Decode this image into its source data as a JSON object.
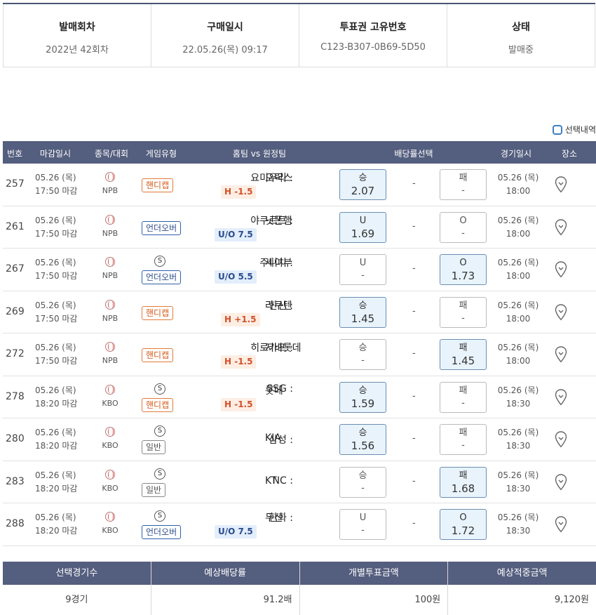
{
  "info": {
    "items": [
      {
        "label": "발매회차",
        "value": "2022년 42회차"
      },
      {
        "label": "구매일시",
        "value": "22.05.26(목) 09:17"
      },
      {
        "label": "투표권 고유번호",
        "value": "C123-B307-0B69-5D50"
      },
      {
        "label": "상태",
        "value": "발매중"
      }
    ]
  },
  "select_label": "선택내역",
  "columns": [
    "번호",
    "마감일시",
    "종목/대회",
    "게임유형",
    "홈팀 vs 원정팀",
    "배당률선택",
    "경기일시",
    "장소"
  ],
  "rows": [
    {
      "no": "257",
      "close_date": "05.26 (목)",
      "close_time": "17:50 마감",
      "league": "NPB",
      "special": "",
      "type": "핸디캡",
      "home": "요미우리",
      "away": "오릭스",
      "handicap": "H -1.5",
      "b1_label": "승",
      "b1_odds": "2.07",
      "b1_on": true,
      "b2_label": "패",
      "b2_odds": "-",
      "b2_on": false,
      "game_date": "05.26 (목)",
      "game_time": "18:00"
    },
    {
      "no": "261",
      "close_date": "05.26 (목)",
      "close_time": "17:50 마감",
      "league": "NPB",
      "special": "",
      "type": "언더오버",
      "home": "야쿠르트",
      "away": "닛폰햄",
      "handicap": "U/O 7.5",
      "b1_label": "U",
      "b1_odds": "1.69",
      "b1_on": true,
      "b2_label": "O",
      "b2_odds": "-",
      "b2_on": false,
      "game_date": "05.26 (목)",
      "game_time": "18:00"
    },
    {
      "no": "267",
      "close_date": "05.26 (목)",
      "close_time": "17:50 마감",
      "league": "NPB",
      "special": "S",
      "type": "언더오버",
      "home": "주니치",
      "away": "세이부",
      "handicap": "U/O 5.5",
      "b1_label": "U",
      "b1_odds": "-",
      "b1_on": false,
      "b2_label": "O",
      "b2_odds": "1.73",
      "b2_on": true,
      "game_date": "05.26 (목)",
      "game_time": "18:00"
    },
    {
      "no": "269",
      "close_date": "05.26 (목)",
      "close_time": "17:50 마감",
      "league": "NPB",
      "special": "",
      "type": "핸디캡",
      "home": "한신",
      "away": "라쿠텐",
      "handicap": "H +1.5",
      "b1_label": "승",
      "b1_odds": "1.45",
      "b1_on": true,
      "b2_label": "패",
      "b2_odds": "-",
      "b2_on": false,
      "game_date": "05.26 (목)",
      "game_time": "18:00"
    },
    {
      "no": "272",
      "close_date": "05.26 (목)",
      "close_time": "17:50 마감",
      "league": "NPB",
      "special": "",
      "type": "핸디캡",
      "home": "히로카프",
      "away": "지바롯데",
      "handicap": "H -1.5",
      "b1_label": "승",
      "b1_odds": "-",
      "b1_on": false,
      "b2_label": "패",
      "b2_odds": "1.45",
      "b2_on": true,
      "game_date": "05.26 (목)",
      "game_time": "18:00"
    },
    {
      "no": "278",
      "close_date": "05.26 (목)",
      "close_time": "18:20 마감",
      "league": "KBO",
      "special": "S",
      "type": "핸디캡",
      "home": "SSG",
      "away": "롯데",
      "handicap": "H -1.5",
      "b1_label": "승",
      "b1_odds": "1.59",
      "b1_on": true,
      "b2_label": "패",
      "b2_odds": "-",
      "b2_on": false,
      "game_date": "05.26 (목)",
      "game_time": "18:30"
    },
    {
      "no": "280",
      "close_date": "05.26 (목)",
      "close_time": "18:20 마감",
      "league": "KBO",
      "special": "S",
      "type": "일반",
      "home": "삼성",
      "away": "KIA",
      "handicap": "",
      "b1_label": "승",
      "b1_odds": "1.56",
      "b1_on": true,
      "b2_label": "패",
      "b2_odds": "-",
      "b2_on": false,
      "game_date": "05.26 (목)",
      "game_time": "18:30"
    },
    {
      "no": "283",
      "close_date": "05.26 (목)",
      "close_time": "18:20 마감",
      "league": "KBO",
      "special": "S",
      "type": "일반",
      "home": "NC",
      "away": "KT",
      "handicap": "",
      "b1_label": "승",
      "b1_odds": "-",
      "b1_on": false,
      "b2_label": "패",
      "b2_odds": "1.68",
      "b2_on": true,
      "game_date": "05.26 (목)",
      "game_time": "18:30"
    },
    {
      "no": "288",
      "close_date": "05.26 (목)",
      "close_time": "18:20 마감",
      "league": "KBO",
      "special": "S",
      "type": "언더오버",
      "home": "한화",
      "away": "두산",
      "handicap": "U/O 7.5",
      "b1_label": "U",
      "b1_odds": "-",
      "b1_on": false,
      "b2_label": "O",
      "b2_odds": "1.72",
      "b2_on": true,
      "game_date": "05.26 (목)",
      "game_time": "18:30"
    }
  ],
  "summary": {
    "headers": [
      "선택경기수",
      "예상배당률",
      "개별투표금액",
      "예상적중금액"
    ],
    "values": [
      "9경기",
      "91.2배",
      "100원",
      "9,120원"
    ]
  },
  "colors": {
    "header_bg": "#545e7e",
    "accent": "#3d7fbf",
    "handicap": "#d2502a",
    "underover": "#2a4c8c"
  }
}
